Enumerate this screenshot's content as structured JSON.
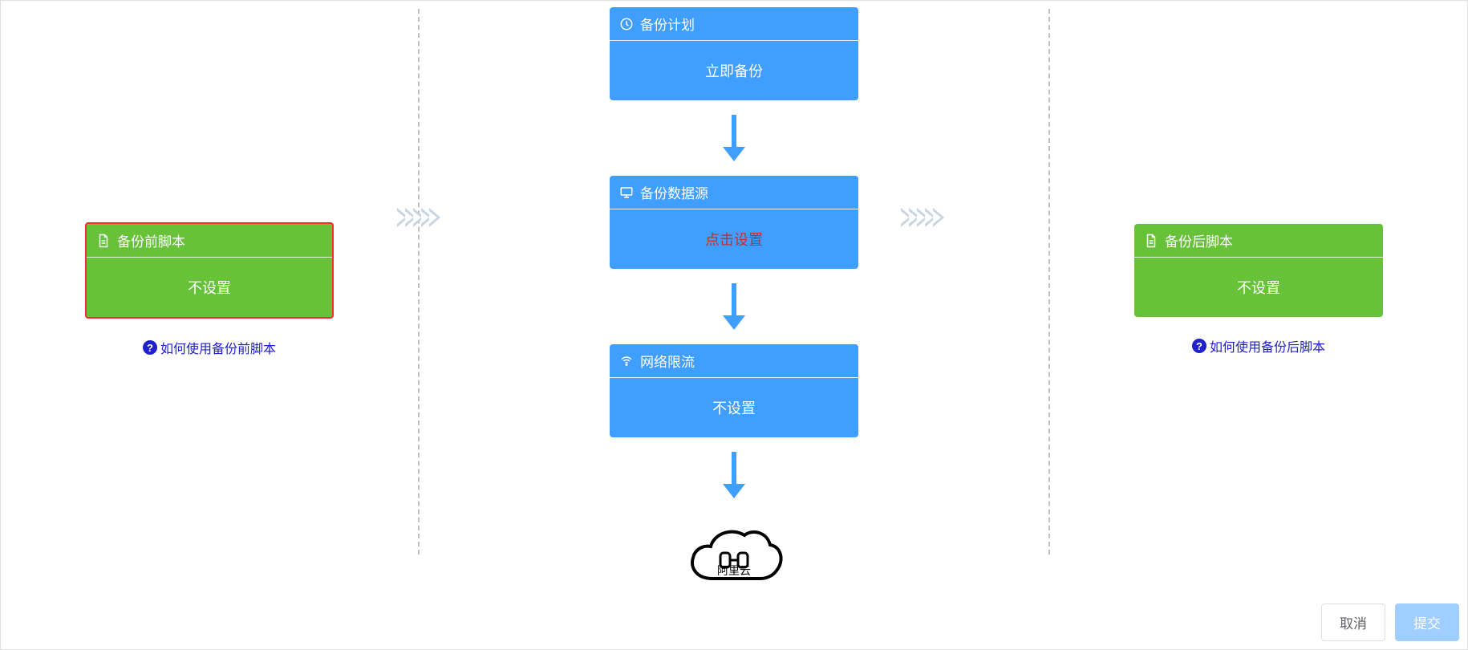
{
  "left": {
    "card": {
      "title": "备份前脚本",
      "body": "不设置"
    },
    "help": "如何使用备份前脚本"
  },
  "center": {
    "plan": {
      "title": "备份计划",
      "body": "立即备份"
    },
    "source": {
      "title": "备份数据源",
      "body": "点击设置"
    },
    "throttle": {
      "title": "网络限流",
      "body": "不设置"
    },
    "cloud_label": "阿里云"
  },
  "right": {
    "card": {
      "title": "备份后脚本",
      "body": "不设置"
    },
    "help": "如何使用备份后脚本"
  },
  "footer": {
    "cancel": "取消",
    "submit": "提交"
  }
}
